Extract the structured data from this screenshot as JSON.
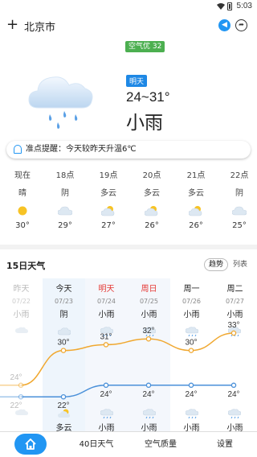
{
  "status_bar": {
    "time": "5:03"
  },
  "header": {
    "city": "北京市",
    "plus_icon": "plus-icon",
    "speaker_icon": "speaker-icon",
    "share_icon": "share-icon"
  },
  "aqi_badge": "空气优 32",
  "current": {
    "tomorrow_label": "明天",
    "temp_range": "24~31°",
    "condition": "小雨",
    "icon": "cloud-rain-icon"
  },
  "alert": {
    "text": "准点提醒：今天较昨天升温6℃",
    "icon": "bell-icon"
  },
  "hourly": [
    {
      "time": "现在",
      "cond": "晴",
      "temp": "30°",
      "icon": "sun-icon"
    },
    {
      "time": "18点",
      "cond": "阴",
      "temp": "29°",
      "icon": "cloud-icon"
    },
    {
      "time": "19点",
      "cond": "多云",
      "temp": "27°",
      "icon": "partly-cloudy-icon"
    },
    {
      "time": "20点",
      "cond": "多云",
      "temp": "26°",
      "icon": "partly-cloudy-icon"
    },
    {
      "time": "21点",
      "cond": "多云",
      "temp": "26°",
      "icon": "partly-cloudy-icon"
    },
    {
      "time": "22点",
      "cond": "阴",
      "temp": "25°",
      "icon": "cloud-icon"
    }
  ],
  "forecast": {
    "title": "15日天气",
    "trend_label": "趋势",
    "list_label": "列表",
    "days": [
      {
        "name": "昨天",
        "date": "07/22",
        "cond": "小雨",
        "high": "24°",
        "low": "22°",
        "night_cond": ""
      },
      {
        "name": "今天",
        "date": "07/23",
        "cond": "阴",
        "high": "30°",
        "low": "22°",
        "night_cond": "多云"
      },
      {
        "name": "明天",
        "date": "07/24",
        "cond": "小雨",
        "high": "31°",
        "low": "24°",
        "night_cond": "小雨"
      },
      {
        "name": "周日",
        "date": "07/25",
        "cond": "小雨",
        "high": "32°",
        "low": "24°",
        "night_cond": "小雨"
      },
      {
        "name": "周一",
        "date": "07/26",
        "cond": "小雨",
        "high": "30°",
        "low": "24°",
        "night_cond": "小雨"
      },
      {
        "name": "周二",
        "date": "07/27",
        "cond": "小雨",
        "high": "33°",
        "low": "24°",
        "night_cond": "小雨"
      }
    ],
    "high_color": "#f0a830",
    "low_color": "#4a90d9"
  },
  "tabs": [
    {
      "label": "",
      "icon": "home-icon"
    },
    {
      "label": "40日天气"
    },
    {
      "label": "空气质量"
    },
    {
      "label": "设置"
    }
  ],
  "colors": {
    "accent": "#2196f3",
    "aqi_good": "#4caf50",
    "weekend_red": "#e53935"
  }
}
